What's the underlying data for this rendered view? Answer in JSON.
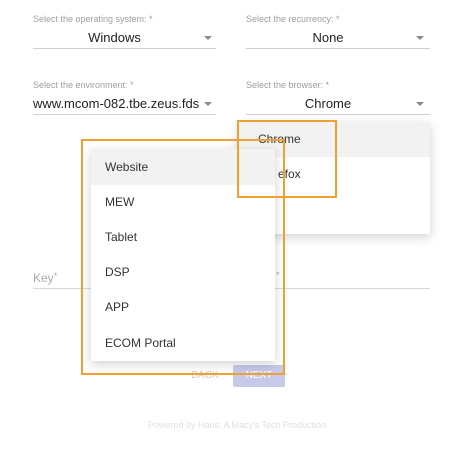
{
  "os": {
    "label": "Select the operating system: *",
    "value": "Windows"
  },
  "recurrency": {
    "label": "Select the recurrency: *",
    "value": "None"
  },
  "environment": {
    "label": "Select the environment: *",
    "value": "www.mcom-082.tbe.zeus.fds"
  },
  "browser": {
    "label": "Select the browser: *",
    "value": "Chrome"
  },
  "browser_menu": {
    "items": [
      "Chrome",
      "efox"
    ]
  },
  "key": {
    "label": "Key",
    "required": "*"
  },
  "second_required": "*",
  "type_menu": {
    "items": [
      "Website",
      "MEW",
      "Tablet",
      "DSP",
      "APP",
      "ECOM Portal"
    ]
  },
  "actions": {
    "back_label": "BACK",
    "next_label": "NEXT"
  },
  "footer": "Powered by Hans. A Macy's Tech Production",
  "colors": {
    "highlight": "#f0a030",
    "primary": "#7986cb"
  }
}
